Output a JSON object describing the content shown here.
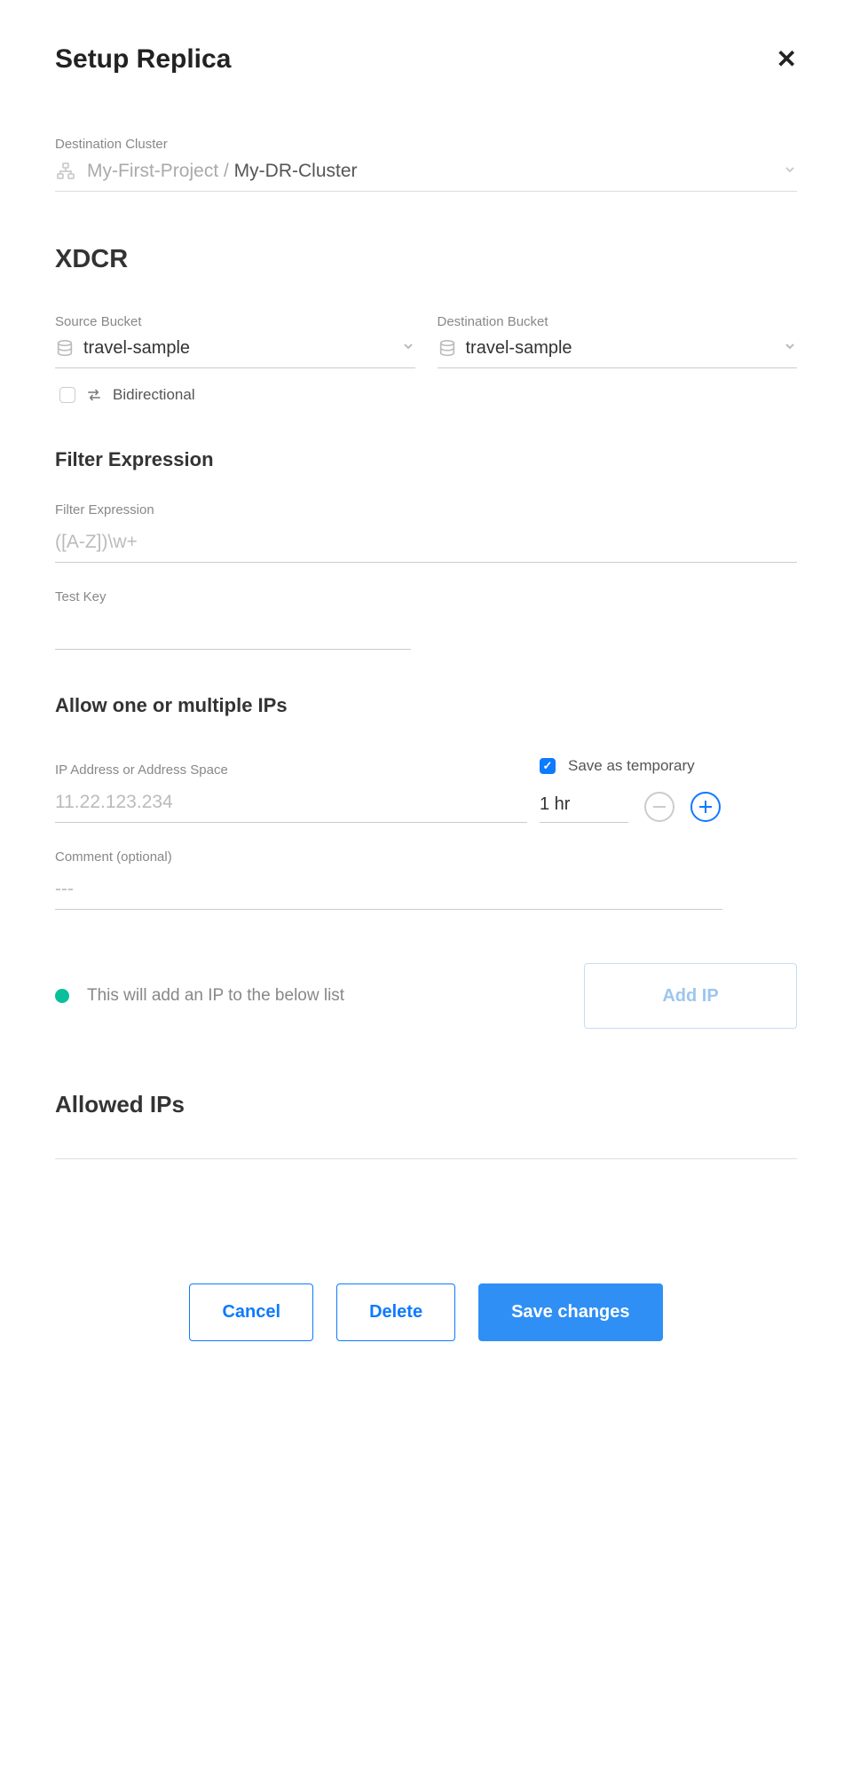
{
  "header": {
    "title": "Setup Replica"
  },
  "destination_cluster": {
    "label": "Destination Cluster",
    "project": "My-First-Project / ",
    "cluster": "My-DR-Cluster"
  },
  "xdcr": {
    "title": "XDCR",
    "source_bucket_label": "Source Bucket",
    "source_bucket_value": "travel-sample",
    "destination_bucket_label": "Destination Bucket",
    "destination_bucket_value": "travel-sample",
    "bidirectional_label": "Bidirectional",
    "bidirectional_checked": false
  },
  "filter": {
    "title": "Filter Expression",
    "expression_label": "Filter Expression",
    "expression_placeholder": "([A-Z])\\w+",
    "test_key_label": "Test Key"
  },
  "ips": {
    "title": "Allow one or multiple IPs",
    "address_label": "IP Address or Address Space",
    "address_placeholder": "11.22.123.234",
    "save_temp_label": "Save as temporary",
    "save_temp_checked": true,
    "duration_value": "1 hr",
    "comment_label": "Comment (optional)",
    "comment_placeholder": "---",
    "hint_text": "This will add an IP to the below list",
    "add_ip_button": "Add IP"
  },
  "allowed": {
    "title": "Allowed IPs"
  },
  "actions": {
    "cancel": "Cancel",
    "delete": "Delete",
    "save": "Save changes"
  }
}
